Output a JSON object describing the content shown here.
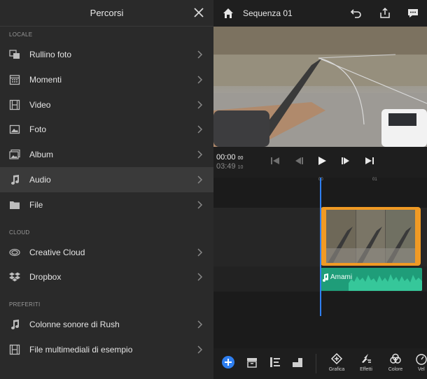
{
  "panel": {
    "title": "Percorsi",
    "sections": [
      {
        "label": "LOCALE",
        "items": [
          "Rullino foto",
          "Momenti",
          "Video",
          "Foto",
          "Album",
          "Audio",
          "File"
        ]
      },
      {
        "label": "CLOUD",
        "items": [
          "Creative Cloud",
          "Dropbox"
        ]
      },
      {
        "label": "PREFERITI",
        "items": [
          "Colonne sonore di Rush",
          "File multimediali di esempio"
        ]
      }
    ],
    "active_item": "Audio"
  },
  "editor": {
    "sequence_title": "Sequenza 01",
    "timecode_current": "00:00",
    "timecode_current_frames": "00",
    "timecode_total": "03:49",
    "timecode_total_frames": "10",
    "ruler": [
      "00",
      "01"
    ],
    "audio_clip_label": "Amami",
    "tools": [
      "Grafica",
      "Effetti",
      "Colore",
      "Vel"
    ]
  },
  "colors": {
    "accent": "#2f7ff0",
    "video_clip": "#f09a24",
    "audio_clip": "#1f9d79"
  }
}
